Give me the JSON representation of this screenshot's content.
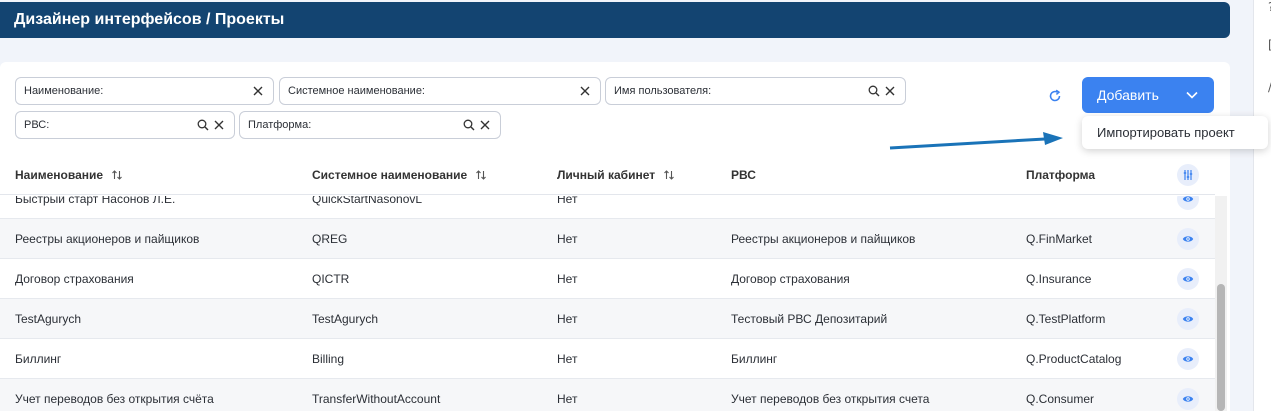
{
  "header": {
    "title": "Дизайнер интерфейсов / Проекты"
  },
  "right_strip": {
    "glyphs": [
      "?",
      "[",
      "/"
    ]
  },
  "filters": {
    "name": "Наименование:",
    "system_name": "Системное наименование:",
    "user_name": "Имя пользователя:",
    "rbs": "РВС:",
    "platform": "Платформа:"
  },
  "toolbar": {
    "add_label": "Добавить",
    "dropdown_item": "Импортировать проект"
  },
  "table": {
    "columns": [
      "Наименование",
      "Системное наименование",
      "Личный кабинет",
      "РВС",
      "Платформа"
    ],
    "rows": [
      [
        "Быстрый старт Насонов Л.Е.",
        "QuickStartNasonovL",
        "Нет",
        "",
        ""
      ],
      [
        "Реестры акционеров и пайщиков",
        "QREG",
        "Нет",
        "Реестры акционеров и пайщиков",
        "Q.FinMarket"
      ],
      [
        "Договор страхования",
        "QICTR",
        "Нет",
        "Договор страхования",
        "Q.Insurance"
      ],
      [
        "TestAgurych",
        "TestAgurych",
        "Нет",
        "Тестовый РВС Депозитарий",
        "Q.TestPlatform"
      ],
      [
        "Биллинг",
        "Billing",
        "Нет",
        "Биллинг",
        "Q.ProductCatalog"
      ],
      [
        "Учет переводов без открытия счёта",
        "TransferWithoutAccount",
        "Нет",
        "Учет переводов без открытия счета",
        "Q.Consumer"
      ]
    ]
  },
  "colors": {
    "header_bg": "#134471",
    "accent": "#3b82f0",
    "arrow": "#1a73b8"
  }
}
